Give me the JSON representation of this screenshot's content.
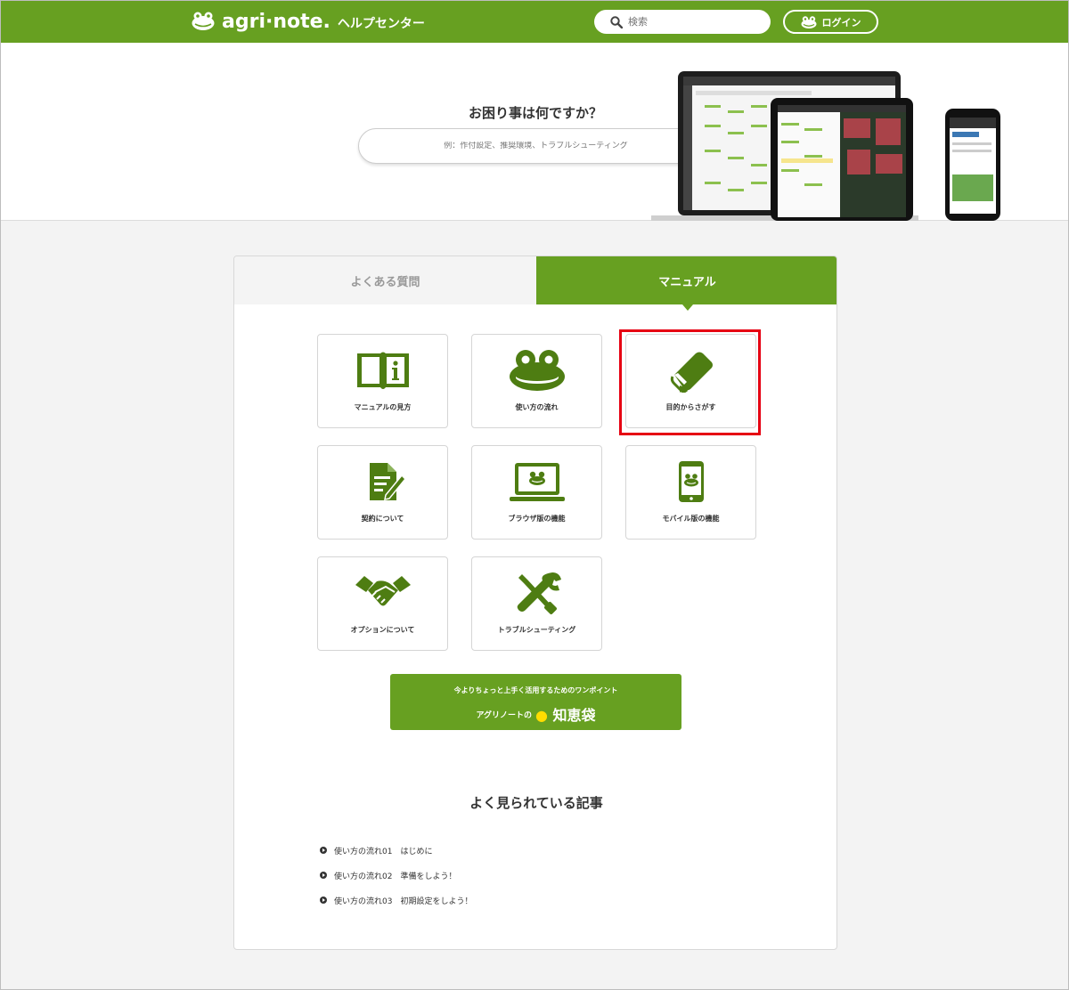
{
  "header": {
    "logo_text": "agri·note.",
    "logo_sub": "ヘルプセンター",
    "search_placeholder": "検索",
    "login_label": "ログイン"
  },
  "hero": {
    "title": "お困り事は何ですか？",
    "search_placeholder": "例：作付設定、推奨環境、トラブルシューティング"
  },
  "tabs": [
    {
      "label": "よくある質問",
      "active": false
    },
    {
      "label": "マニュアル",
      "active": true
    }
  ],
  "cards": [
    {
      "label": "マニュアルの見方",
      "icon": "book-info-icon"
    },
    {
      "label": "使い方の流れ",
      "icon": "frog-icon"
    },
    {
      "label": "目的からさがす",
      "icon": "closed-book-icon"
    },
    {
      "label": "契約について",
      "icon": "contract-document-icon"
    },
    {
      "label": "ブラウザ版の機能",
      "icon": "laptop-frog-icon"
    },
    {
      "label": "モバイル版の機能",
      "icon": "smartphone-frog-icon"
    },
    {
      "label": "オプションについて",
      "icon": "handshake-icon"
    },
    {
      "label": "トラブルシューティング",
      "icon": "tools-icon"
    }
  ],
  "banner": {
    "line1": "今よりちょっと上手く活用するためのワンポイント",
    "prefix": "アグリノートの",
    "title": "知恵袋"
  },
  "popular": {
    "title": "よく見られている記事",
    "articles": [
      "使い方の流れ01　はじめに",
      "使い方の流れ02　準備をしよう！",
      "使い方の流れ03　初期設定をしよう！"
    ]
  },
  "colors": {
    "brand_green": "#67a021",
    "highlight_red": "#e60012",
    "icon_green": "#4e7d12"
  }
}
